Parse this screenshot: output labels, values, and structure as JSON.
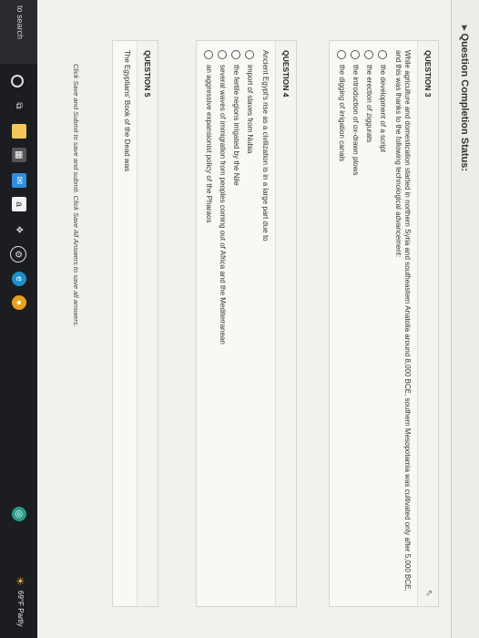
{
  "header": {
    "status_title": "Question Completion Status:"
  },
  "questions": [
    {
      "title": "QUESTION 3",
      "text": "While agriculture and domestication started in northern Syria and southeastern Anatolia around 8,000 BCE, southern Mesopotamia was cultivated only after 5,000 BCE, and this was thanks to the following technological advancement:",
      "options": [
        "the development of a script",
        "the erection of ziggurats",
        "the introduction of ox-drawn plows",
        "the digging of irrigation canals"
      ]
    },
    {
      "title": "QUESTION 4",
      "text": "Ancient Egypt's rise as a civilization is in a large part due to",
      "options": [
        "import of slaves from Nubia",
        "the fertile regions irrigated by the Nile",
        "several waves of immigration from peoples coming out of Africa and the Mediterranean",
        "an aggressive expansionist policy of the Pharaos"
      ]
    },
    {
      "title": "QUESTION 5",
      "text": "The Egyptians' Book of the Dead was",
      "options": []
    }
  ],
  "footer": {
    "note": "Click Save and Submit to save and submit. Click Save All Answers to save all answers."
  },
  "taskbar": {
    "search_text": "to search",
    "weather": "69°F  Partly"
  },
  "colors": {
    "taskbar_bg": "#1c1d20",
    "page_bg": "#f1f1ee"
  }
}
